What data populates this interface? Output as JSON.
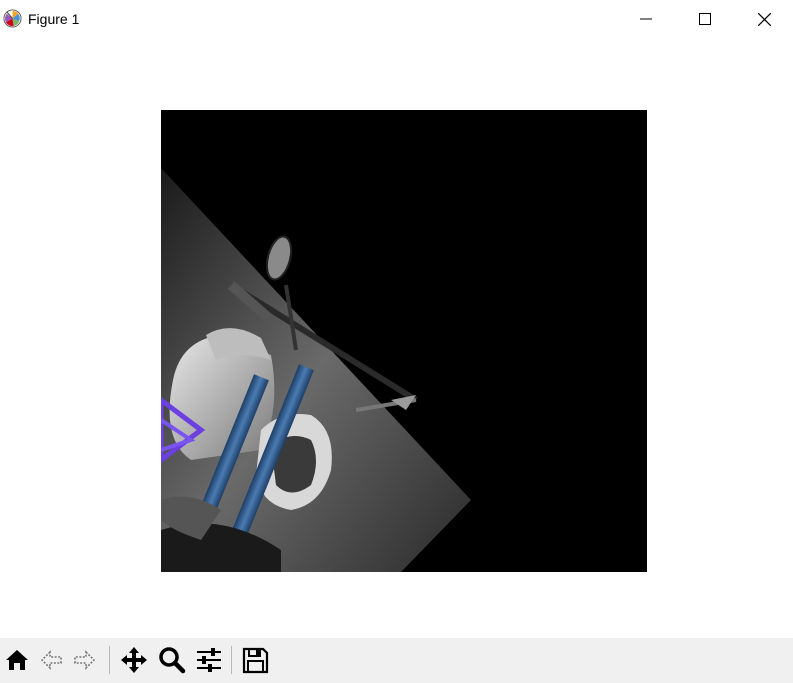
{
  "window": {
    "title": "Figure 1"
  },
  "titlebar_buttons": {
    "minimize": "minimize-icon",
    "maximize": "maximize-icon",
    "close": "close-icon"
  },
  "figure": {
    "image_description_icon": "motorcycle-photo"
  },
  "toolbar": {
    "buttons": [
      {
        "icon": "home-icon"
      },
      {
        "icon": "back-arrow-icon"
      },
      {
        "icon": "forward-arrow-icon"
      },
      {
        "icon": "pan-icon"
      },
      {
        "icon": "zoom-icon"
      },
      {
        "icon": "configure-subplots-icon"
      },
      {
        "icon": "save-icon"
      }
    ]
  }
}
